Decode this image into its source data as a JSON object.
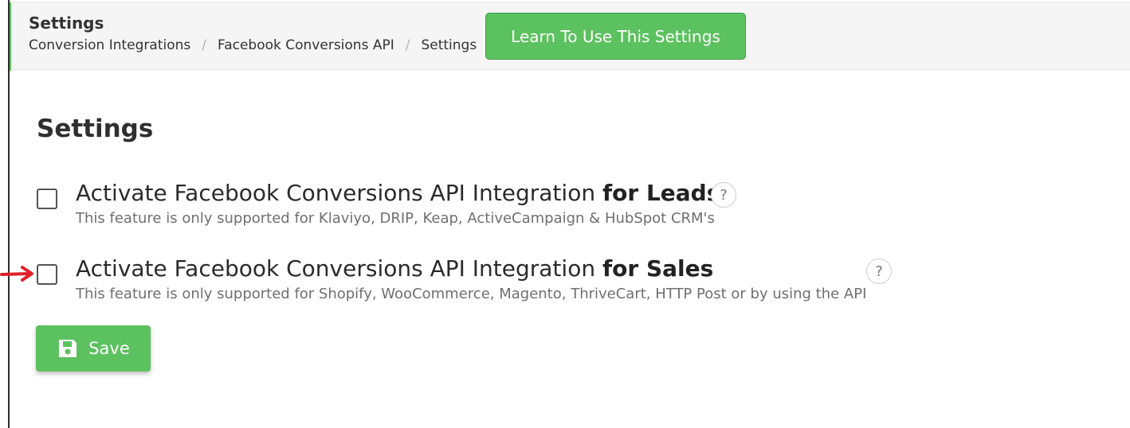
{
  "header": {
    "title": "Settings",
    "breadcrumb": [
      "Conversion Integrations",
      "Facebook Conversions API",
      "Settings"
    ],
    "breadcrumb_separator": "/",
    "learn_button_label": "Learn To Use This Settings"
  },
  "page": {
    "title": "Settings"
  },
  "settings": [
    {
      "label_prefix": "Activate Facebook Conversions API Integration",
      "label_bold": "for Leads",
      "description": "This feature is only supported for Klaviyo, DRIP, Keap, ActiveCampaign & HubSpot CRM's",
      "checked": false,
      "help": "?"
    },
    {
      "label_prefix": "Activate Facebook Conversions API Integration",
      "label_bold": "for Sales",
      "description": "This feature is only supported for Shopify, WooCommerce, Magento, ThriveCart, HTTP Post or by using the API",
      "checked": false,
      "help": "?"
    }
  ],
  "save_button": {
    "label": "Save",
    "icon": "floppy-disk-icon"
  },
  "colors": {
    "accent_green": "#5cc15f",
    "annotation_arrow": "#e0202a"
  }
}
